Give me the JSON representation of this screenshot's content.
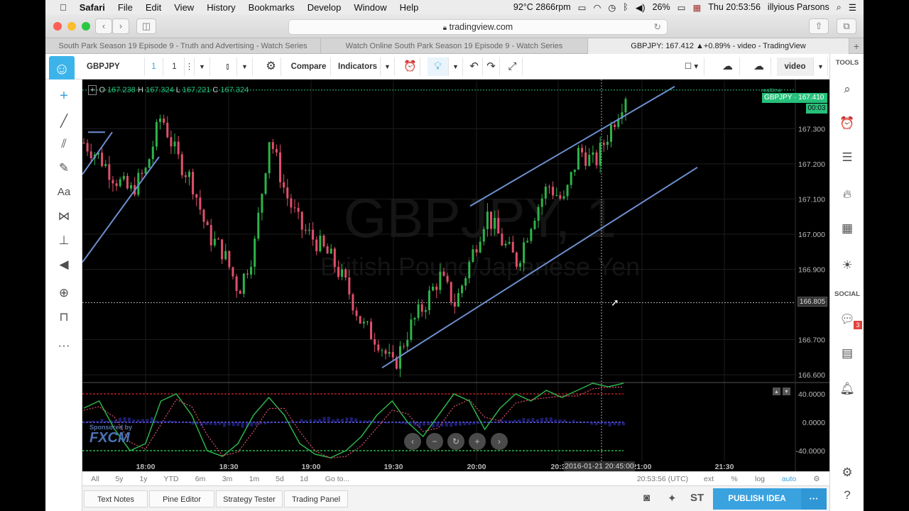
{
  "menubar": {
    "apple": "",
    "app": "Safari",
    "items": [
      "File",
      "Edit",
      "View",
      "History",
      "Bookmarks",
      "Develop",
      "Window",
      "Help"
    ],
    "temp": "92°C 2866rpm",
    "battery": "26%",
    "clock": "Thu 20:53:56",
    "user": "illyious Parsons"
  },
  "browser": {
    "url": "tradingview.com",
    "tabs": [
      "South Park Season 19 Episode 9 - Truth and Advertising - Watch Series",
      "Watch Online South Park Season 19 Episode 9 - Watch Series",
      "GBPJPY: 167.412 ▲+0.89% - video - TradingView"
    ]
  },
  "tv_toolbar": {
    "symbol": "GBPJPY",
    "interval": "1",
    "interval2": "1",
    "compare": "Compare",
    "indicators": "Indicators",
    "layout_name": "video"
  },
  "right_panel": {
    "tools_label": "TOOLS",
    "social_label": "SOCIAL",
    "chat_badge": "3"
  },
  "chart_data": {
    "type": "candlestick",
    "symbol": "GBPJPY",
    "watermark_symbol": "GBPJPY, 1",
    "watermark_name": "British Pound/Japanese Yen",
    "ohlc": {
      "o_label": "O",
      "o": "167.238",
      "h_label": "H",
      "h": "167.324",
      "l_label": "L",
      "l": "167.221",
      "c_label": "C",
      "c": "167.324"
    },
    "last_price_label": "GBPJPY · 167.410",
    "countdown": "00:03",
    "realtime": "realtime",
    "crosshair_price": "166.805",
    "crosshair_time": "2016-01-21 20:45:00",
    "price_axis": [
      "167.300",
      "167.200",
      "167.100",
      "167.000",
      "166.900",
      "166.700",
      "166.600"
    ],
    "ylim": [
      166.58,
      167.44
    ],
    "time_axis": [
      {
        "t": "18:00"
      },
      {
        "t": "18:30"
      },
      {
        "t": "19:00"
      },
      {
        "t": "19:30"
      },
      {
        "t": "20:00"
      },
      {
        "t": "20:3"
      },
      {
        "t": "21:00"
      },
      {
        "t": "21:30"
      }
    ],
    "close_path": [
      167.26,
      167.22,
      167.16,
      167.12,
      167.18,
      167.34,
      167.22,
      167.15,
      167.0,
      166.95,
      166.84,
      166.96,
      167.28,
      167.12,
      167.02,
      166.98,
      166.93,
      166.85,
      166.74,
      166.7,
      166.62,
      166.73,
      166.8,
      166.88,
      166.8,
      166.93,
      167.06,
      166.98,
      166.92,
      167.05,
      167.14,
      167.09,
      167.24,
      167.2,
      167.3,
      167.4
    ],
    "oscillator": {
      "levels": [
        "40.0000",
        "0.0000",
        "-40.0000"
      ],
      "ylim": [
        -55,
        55
      ],
      "k": [
        20,
        30,
        -10,
        -40,
        -30,
        30,
        40,
        10,
        -40,
        -48,
        -30,
        10,
        35,
        10,
        -30,
        -45,
        -50,
        -40,
        -20,
        10,
        30,
        0,
        -20,
        10,
        40,
        30,
        -10,
        20,
        40,
        30,
        45,
        35,
        45,
        55,
        50,
        55
      ]
    }
  },
  "chart_overlay": {
    "sponsored": "Sponsored by",
    "fxcm": "FXCM"
  },
  "bottom": {
    "ranges": [
      "All",
      "5y",
      "1y",
      "YTD",
      "6m",
      "3m",
      "1m",
      "5d",
      "1d",
      "Go to..."
    ],
    "clock": "20:53:56 (UTC)",
    "ext": "ext",
    "pct": "%",
    "log": "log",
    "auto": "auto"
  },
  "panels": {
    "text_notes": "Text Notes",
    "pine": "Pine Editor",
    "strategy": "Strategy Tester",
    "trading": "Trading Panel",
    "publish": "PUBLISH IDEA",
    "dots": "···",
    "st": "ST"
  }
}
